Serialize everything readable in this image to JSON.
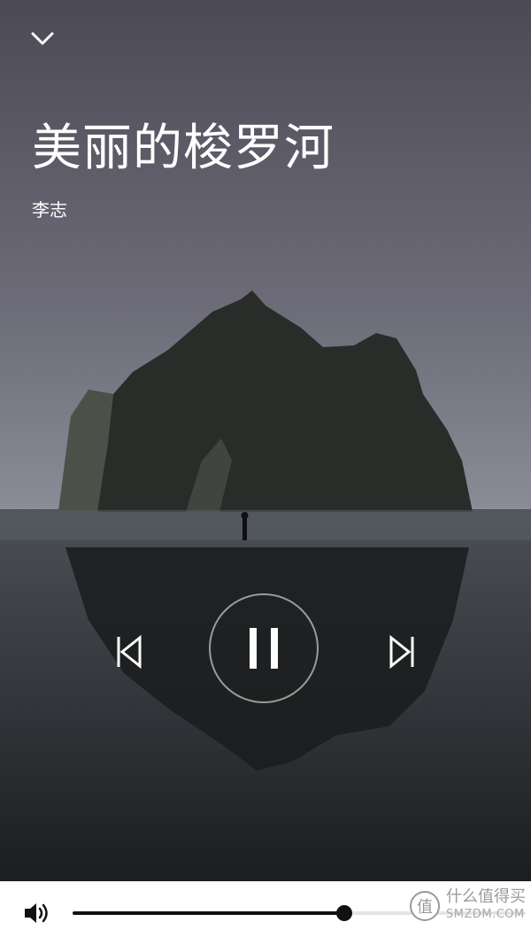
{
  "player": {
    "title": "美丽的梭罗河",
    "artist": "李志",
    "state": "playing"
  },
  "volume": {
    "level": 0.6
  },
  "icons": {
    "collapse": "chevron-down-icon",
    "previous": "skip-previous-icon",
    "pause": "pause-icon",
    "next": "skip-next-icon",
    "volume": "speaker-icon"
  },
  "watermark": {
    "cn": "什么值得买",
    "en": "SMZDM.COM"
  },
  "colors": {
    "overlay_text": "#ffffff",
    "progress_fill": "#111111",
    "progress_track": "#e4e4e4"
  }
}
